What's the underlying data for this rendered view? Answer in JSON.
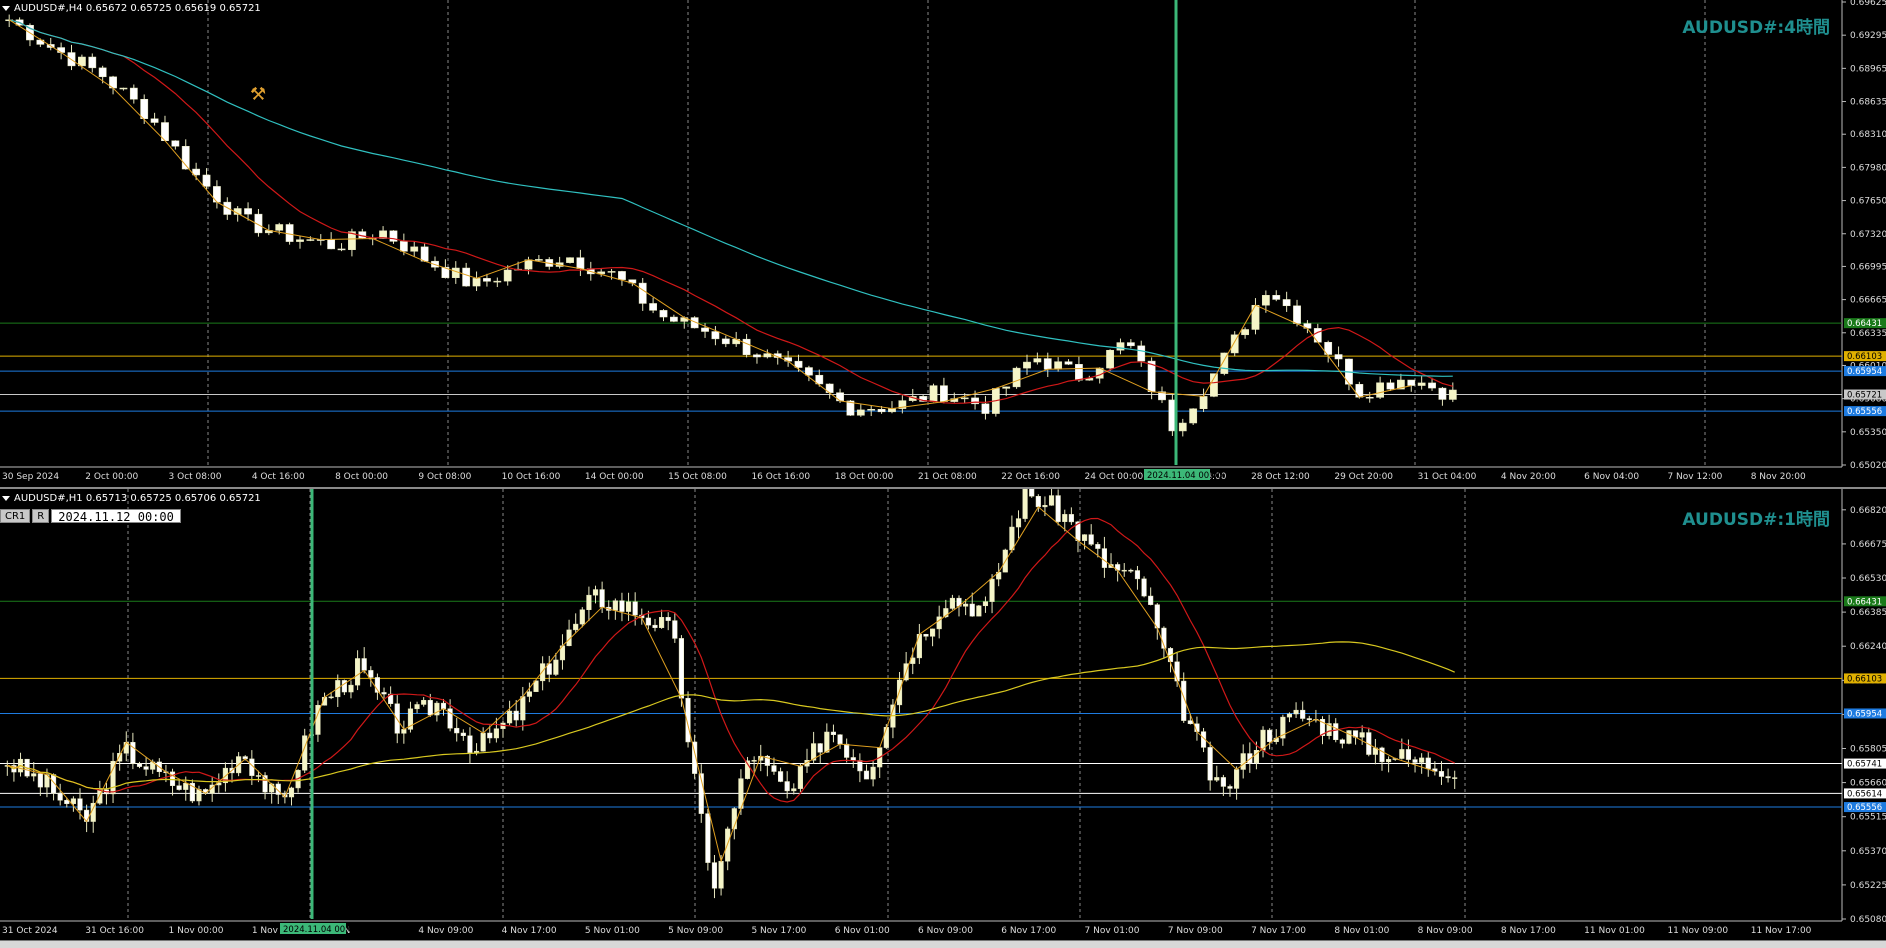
{
  "top_pane": {
    "header": "AUDUSD#,H4  0.65672 0.65725 0.65619 0.65721",
    "title": "AUDUSD#:4時間",
    "y_ticks": [
      "0.69625",
      "0.69295",
      "0.68965",
      "0.68635",
      "0.68310",
      "0.67980",
      "0.67650",
      "0.67320",
      "0.66995",
      "0.66665",
      "0.66335",
      "0.66010",
      "0.65680",
      "0.65350",
      "0.65020"
    ],
    "x_ticks": [
      "30 Sep 2024",
      "2 Oct 00:00",
      "3 Oct 08:00",
      "4 Oct 16:00",
      "8 Oct 00:00",
      "9 Oct 08:00",
      "10 Oct 16:00",
      "14 Oct 00:00",
      "15 Oct 08:00",
      "16 Oct 16:00",
      "18 Oct 00:00",
      "21 Oct 08:00",
      "22 Oct 16:00",
      "24 Oct 00:00",
      "25 Oct 08:00",
      "28 Oct 12:00",
      "29 Oct 20:00",
      "31 Oct 04:00",
      "4 Nov 20:00",
      "6 Nov 04:00",
      "7 Nov 12:00",
      "8 Nov 20:00"
    ],
    "cursor_date": "2024.11.04 00:00",
    "price_tags": [
      {
        "label": "0.66431",
        "color": "#1a7a1a",
        "price": 0.66431
      },
      {
        "label": "0.66103",
        "color": "#e0b000",
        "price": 0.66103
      },
      {
        "label": "0.65954",
        "color": "#1e7be0",
        "price": 0.65954
      },
      {
        "label": "0.65721",
        "color": "#c8c8c8",
        "price": 0.65721
      },
      {
        "label": "0.65556",
        "color": "#1e7be0",
        "price": 0.65556
      }
    ]
  },
  "bottom_pane": {
    "header": "AUDUSD#,H1  0.65713 0.65725 0.65706 0.65721",
    "title": "AUDUSD#:1時間",
    "crosshair_label": "CR1",
    "crosshair_btn": "R",
    "crosshair_date": "2024.11.12 00:00",
    "y_ticks": [
      "0.66820",
      "0.66675",
      "0.66530",
      "0.66385",
      "0.66240",
      "0.66095",
      "0.65950",
      "0.65805",
      "0.65660",
      "0.65515",
      "0.65370",
      "0.65225",
      "0.65080"
    ],
    "x_ticks": [
      "31 Oct 2024",
      "31 Oct 16:00",
      "1 Nov 00:00",
      "1 Nov 08:00",
      "1 N",
      "4 Nov 09:00",
      "4 Nov 17:00",
      "5 Nov 01:00",
      "5 Nov 09:00",
      "5 Nov 17:00",
      "6 Nov 01:00",
      "6 Nov 09:00",
      "6 Nov 17:00",
      "7 Nov 01:00",
      "7 Nov 09:00",
      "7 Nov 17:00",
      "8 Nov 01:00",
      "8 Nov 09:00",
      "8 Nov 17:00",
      "11 Nov 01:00",
      "11 Nov 09:00",
      "11 Nov 17:00"
    ],
    "cursor_date": "2024.11.04 00:00",
    "price_tags": [
      {
        "label": "0.66431",
        "color": "#1a7a1a",
        "price": 0.66431
      },
      {
        "label": "0.66103",
        "color": "#e0b000",
        "price": 0.66103
      },
      {
        "label": "0.65954",
        "color": "#1e7be0",
        "price": 0.65954
      },
      {
        "label": "0.65741",
        "color": "#ffffff",
        "price": 0.65741
      },
      {
        "label": "0.65614",
        "color": "#ffffff",
        "price": 0.65614
      },
      {
        "label": "0.65556",
        "color": "#1e7be0",
        "price": 0.65556
      }
    ]
  },
  "colors": {
    "bull": "#f5f5c8",
    "bear": "#ffffff",
    "ma_red": "#d01818",
    "ma_cyan": "#30c0c0",
    "ma_yellow": "#d8c820",
    "zigzag": "#e0a020",
    "cursor": "#3cb878",
    "grid": "#888"
  }
}
